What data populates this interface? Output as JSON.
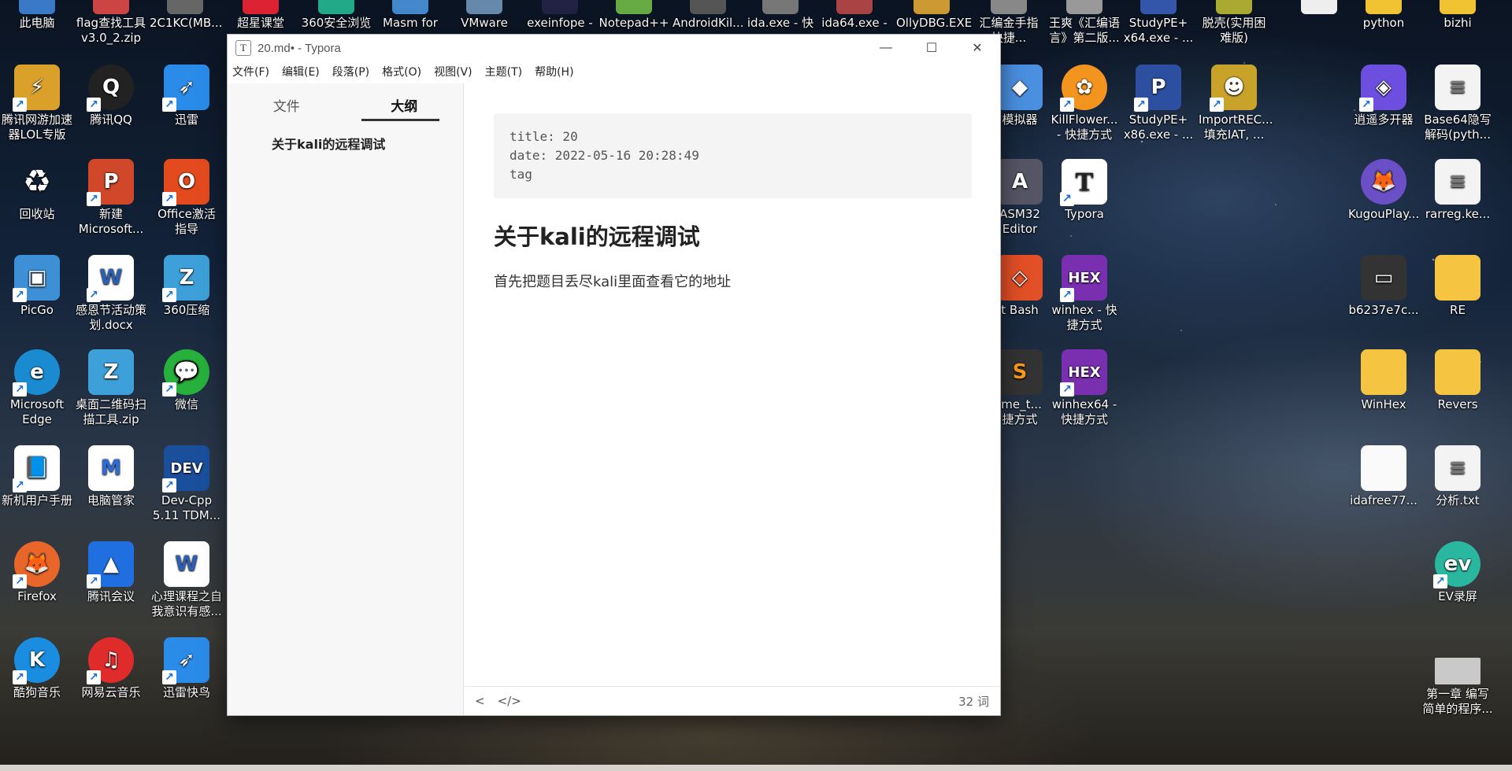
{
  "window": {
    "title": "20.md• - Typora",
    "app_icon": "T",
    "controls": {
      "minimize": "—",
      "maximize": "☐",
      "close": "✕"
    }
  },
  "menu": [
    "文件(F)",
    "编辑(E)",
    "段落(P)",
    "格式(O)",
    "视图(V)",
    "主题(T)",
    "帮助(H)"
  ],
  "sidebar": {
    "tabs": [
      "文件",
      "大纲"
    ],
    "active_tab": "大纲",
    "outline": [
      "关于kali的远程调试"
    ]
  },
  "document": {
    "frontmatter": [
      "title: 20",
      "date: 2022-05-16 20:28:49",
      "tag"
    ],
    "heading": "关于kali的远程调试",
    "paragraph": "首先把题目丢尽kali里面查看它的地址"
  },
  "status": {
    "back_icon": "<",
    "source_icon": "</>",
    "word_count": "32 词"
  },
  "desktop_top_row": [
    "此电脑",
    "flag查找工具\nv3.0_2.zip",
    "2C1KC(MB...",
    "超星课堂",
    "360安全浏览",
    "Masm for",
    "VMware",
    "exeinfope -",
    "Notepad++",
    "AndroidKil...",
    "ida.exe - 快",
    "ida64.exe -",
    "OllyDBG.EXE",
    "汇编金手指\n快捷...",
    "王爽《汇编语\n言》第二版...",
    "StudyPE+\nx64.exe - ...",
    "脱壳(实用困\n难版)",
    "",
    "python",
    "bizhi"
  ],
  "desktop_left": [
    "腾讯网游加速\n器LOL专版",
    "腾讯QQ",
    "迅雷",
    "回收站",
    "新建\nMicrosoft...",
    "Office激活\n指导",
    "PicGo",
    "感恩节活动策\n划.docx",
    "360压缩",
    "Microsoft\nEdge",
    "桌面二维码扫\n描工具.zip",
    "微信",
    "新机用户手册",
    "电脑管家",
    "Dev-Cpp\n5.11 TDM...",
    "Firefox",
    "腾讯会议",
    "心理课程之自\n我意识有感...",
    "酷狗音乐",
    "网易云音乐",
    "迅雷快鸟"
  ],
  "desktop_right": [
    "模拟器",
    "KillFlower...\n- 快捷方式",
    "StudyPE+\nx86.exe - ...",
    "ImportREC...\n填充IAT, ...",
    "ASM32\nEditor",
    "Typora",
    "t Bash",
    "winhex - 快\n捷方式",
    "ime_t...\n捷方式",
    "winhex64 -\n快捷方式",
    "逍遥多开器",
    "Base64隐写\n解码(pyth...",
    "KugouPlay...",
    "rarreg.ke...",
    "b6237e7c...",
    "RE",
    "WinHex",
    "Revers",
    "idafree77...",
    "分析.txt",
    "EV录屏",
    "第一章 编写\n简单的程序..."
  ],
  "colors": {
    "accent": "#333333",
    "sidebar_bg": "#f7f7f7",
    "code_bg": "#f4f4f4"
  }
}
